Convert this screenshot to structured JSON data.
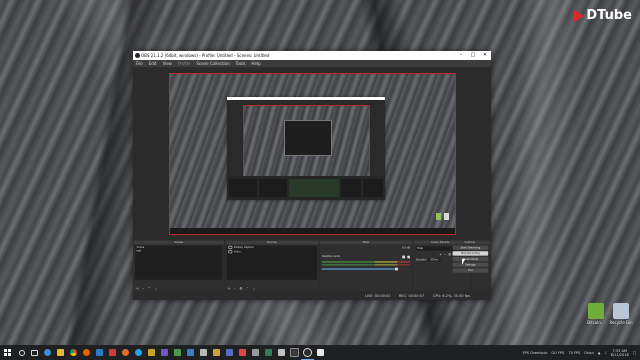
{
  "brand": {
    "logo_text": "DTube",
    "accent": "#e3262b"
  },
  "desktop_icons": [
    {
      "label": "Bitcoin...",
      "color": "#6fae3b"
    },
    {
      "label": "Recycle Bin",
      "color": "#b9c6d6"
    }
  ],
  "obs": {
    "title": "OBS 21.1.2 (64bit, windows) - Profile: Untitled - Scenes: Untitled",
    "menu": [
      "File",
      "Edit",
      "View",
      "Profile",
      "Scene Collection",
      "Tools",
      "Help"
    ],
    "docks": {
      "scenes": {
        "title": "Scenes",
        "items": [
          "Scene",
          "test"
        ]
      },
      "sources": {
        "title": "Sources",
        "items": [
          "Display Capture",
          "Orion"
        ]
      },
      "mixer": {
        "title": "Mixer",
        "track_name": "Desktop Audio",
        "track_db": "0.0 dB"
      },
      "transitions": {
        "title": "Scene Transitions",
        "selected": "Fade",
        "duration_label": "Duration",
        "duration_value": "300ms"
      },
      "controls": {
        "title": "Controls",
        "buttons": [
          "Start Streaming",
          "Stop Recording",
          "Studio Mode",
          "Settings",
          "Exit"
        ]
      }
    },
    "status": {
      "live": "LIVE: 00:00:00",
      "rec": "REC: 00:00:07",
      "cpu": "CPU: 6.2%, 30.00 fps"
    }
  },
  "taskbar": {
    "tray_items": [
      "FPS Overclock",
      "GO FPS",
      "75 FPS",
      "Orion"
    ],
    "time": "7:33 AM",
    "date": "8/11/2018"
  }
}
